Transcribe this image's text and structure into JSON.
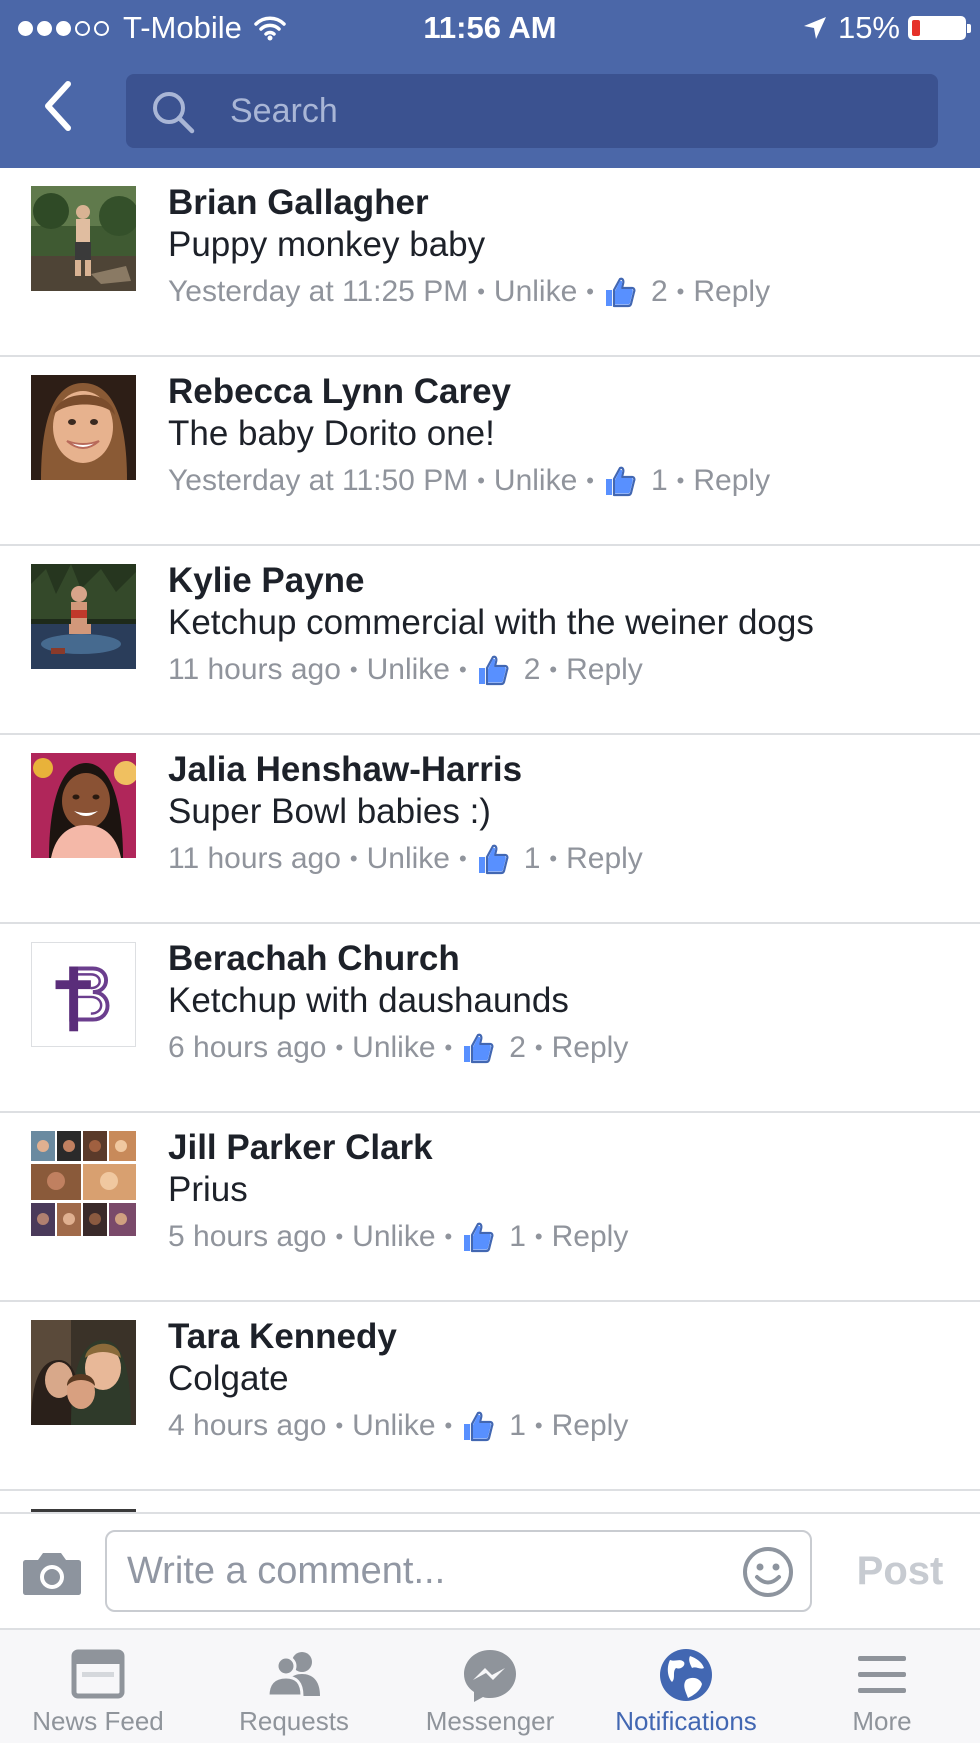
{
  "status_bar": {
    "signal_dots_filled": 3,
    "signal_dots_total": 5,
    "carrier": "T-Mobile",
    "time": "11:56 AM",
    "battery_percent_label": "15%",
    "battery_level": 0.15,
    "icons": [
      "wifi-icon",
      "location-arrow-icon",
      "battery-icon"
    ]
  },
  "header": {
    "back_icon": "chevron-left-icon",
    "search": {
      "placeholder": "Search",
      "value": "",
      "icon": "search-icon"
    }
  },
  "comments": [
    {
      "author": "Brian Gallagher",
      "text": "Puppy monkey baby",
      "time": "Yesterday at 11:25 PM",
      "like_action": "Unlike",
      "likes": "2",
      "reply_label": "Reply"
    },
    {
      "author": "Rebecca Lynn Carey",
      "text": "The baby Dorito one!",
      "time": "Yesterday at 11:50 PM",
      "like_action": "Unlike",
      "likes": "1",
      "reply_label": "Reply"
    },
    {
      "author": "Kylie Payne",
      "text": "Ketchup commercial with the weiner dogs",
      "time": "11 hours ago",
      "like_action": "Unlike",
      "likes": "2",
      "reply_label": "Reply"
    },
    {
      "author": "Jalia Henshaw-Harris",
      "text": "Super Bowl babies :)",
      "time": "11 hours ago",
      "like_action": "Unlike",
      "likes": "1",
      "reply_label": "Reply"
    },
    {
      "author": "Berachah Church",
      "text": "Ketchup with daushaunds",
      "time": "6 hours ago",
      "like_action": "Unlike",
      "likes": "2",
      "reply_label": "Reply"
    },
    {
      "author": "Jill Parker Clark",
      "text": "Prius",
      "time": "5 hours ago",
      "like_action": "Unlike",
      "likes": "1",
      "reply_label": "Reply"
    },
    {
      "author": "Tara Kennedy",
      "text": "Colgate",
      "time": "4 hours ago",
      "like_action": "Unlike",
      "likes": "1",
      "reply_label": "Reply"
    }
  ],
  "composer": {
    "camera_icon": "camera-icon",
    "placeholder": "Write a comment...",
    "value": "",
    "emoji_icon": "smiley-icon",
    "post_label": "Post"
  },
  "tabs": [
    {
      "label": "News Feed",
      "icon": "news-feed-icon",
      "active": false
    },
    {
      "label": "Requests",
      "icon": "friend-requests-icon",
      "active": false
    },
    {
      "label": "Messenger",
      "icon": "messenger-icon",
      "active": false
    },
    {
      "label": "Notifications",
      "icon": "globe-icon",
      "active": true
    },
    {
      "label": "More",
      "icon": "hamburger-menu-icon",
      "active": false
    }
  ],
  "colors": {
    "brand_blue": "#4b67a8",
    "search_bg": "#3b5290",
    "active_tab": "#4267b2",
    "meta_gray": "#90949c",
    "battery_low": "#e5312a"
  }
}
